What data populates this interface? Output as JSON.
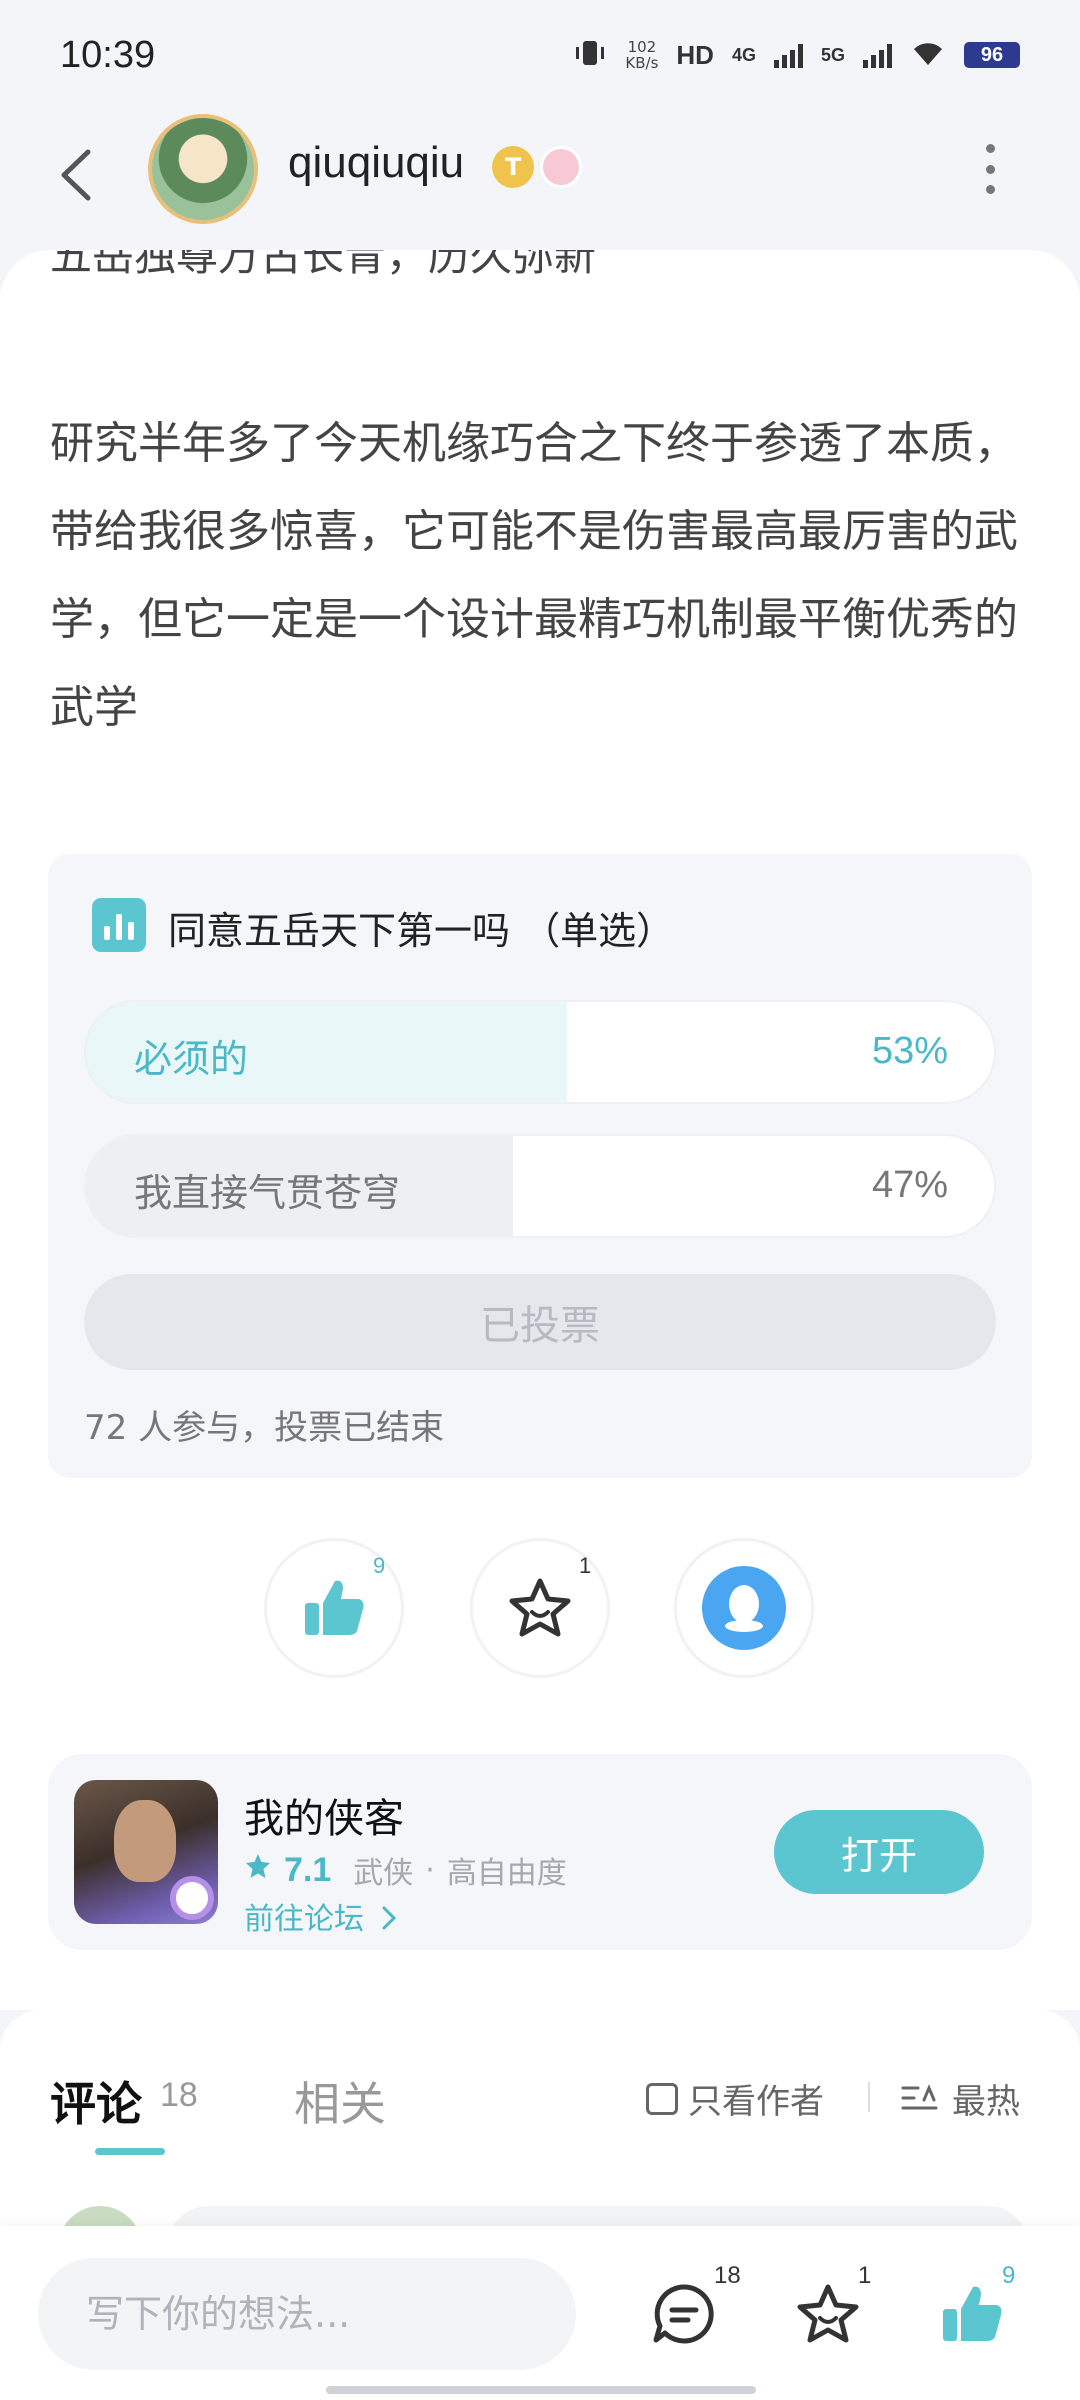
{
  "status_bar": {
    "time": "10:39",
    "net_speed_value": "102",
    "net_speed_unit": "KB/s",
    "hd_label": "HD",
    "net_4g": "4G",
    "net_5g": "5G",
    "battery": "96"
  },
  "header": {
    "username": "qiuqiuqiu",
    "badge_letter": "T"
  },
  "post": {
    "clipped_line": "五岳独尊万古长青，历久弥新",
    "body": "研究半年多了今天机缘巧合之下终于参透了本质，带给我很多惊喜，它可能不是伤害最高最厉害的武学，但它一定是一个设计最精巧机制最平衡优秀的武学"
  },
  "poll": {
    "title": "同意五岳天下第一吗 （单选）",
    "options": [
      {
        "label": "必须的",
        "percent_text": "53%",
        "percent": 53,
        "selected": true
      },
      {
        "label": "我直接气贯苍穹",
        "percent_text": "47%",
        "percent": 47,
        "selected": false
      }
    ],
    "button_label": "已投票",
    "stat": "72 人参与，投票已结束"
  },
  "actions": {
    "like_count": "9",
    "favorite_count": "1"
  },
  "game": {
    "name": "我的侠客",
    "rating": "7.1",
    "tags": [
      "武侠",
      "高自由度"
    ],
    "separator": "·",
    "forum_link": "前往论坛",
    "open_button": "打开"
  },
  "comments": {
    "tab_comments": "评论",
    "comment_count": "18",
    "tab_related": "相关",
    "author_only": "只看作者",
    "sort": "最热"
  },
  "bottom_bar": {
    "input_placeholder": "写下你的想法...",
    "comment_count": "18",
    "favorite_count": "1",
    "like_count": "9"
  },
  "colors": {
    "accent": "#5cc6d0",
    "accent_text": "#4ab8c6",
    "poll_selected_fill": "#eaf7f9",
    "poll_unselected_fill": "#edeff2",
    "qq_blue": "#4aa6f0"
  }
}
